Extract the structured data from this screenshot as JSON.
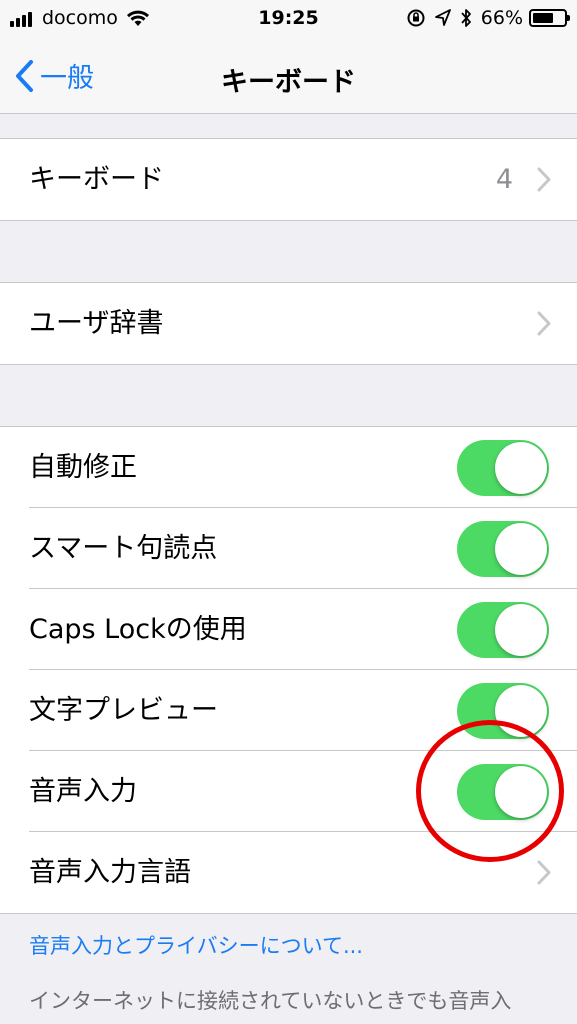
{
  "status_bar": {
    "carrier": "docomo",
    "time": "19:25",
    "battery_percent": "66%",
    "battery_level": 0.66
  },
  "nav": {
    "back_label": "一般",
    "title": "キーボード"
  },
  "groups": {
    "keyboards": {
      "label": "キーボード",
      "value": "4"
    },
    "user_dictionary": {
      "label": "ユーザ辞書"
    },
    "settings": {
      "auto_correct": {
        "label": "自動修正",
        "on": true
      },
      "smart_punctuation": {
        "label": "スマート句読点",
        "on": true
      },
      "caps_lock": {
        "label": "Caps Lockの使用",
        "on": true
      },
      "char_preview": {
        "label": "文字プレビュー",
        "on": true
      },
      "dictation": {
        "label": "音声入力",
        "on": true
      },
      "dictation_languages": {
        "label": "音声入力言語"
      }
    }
  },
  "footer": {
    "privacy_link": "音声入力とプライバシーについて...",
    "note": "インターネットに接続されていないときでも音声入"
  },
  "colors": {
    "accent": "#1a7cf5",
    "toggle_on": "#4cd964",
    "annotation": "#e80000"
  }
}
